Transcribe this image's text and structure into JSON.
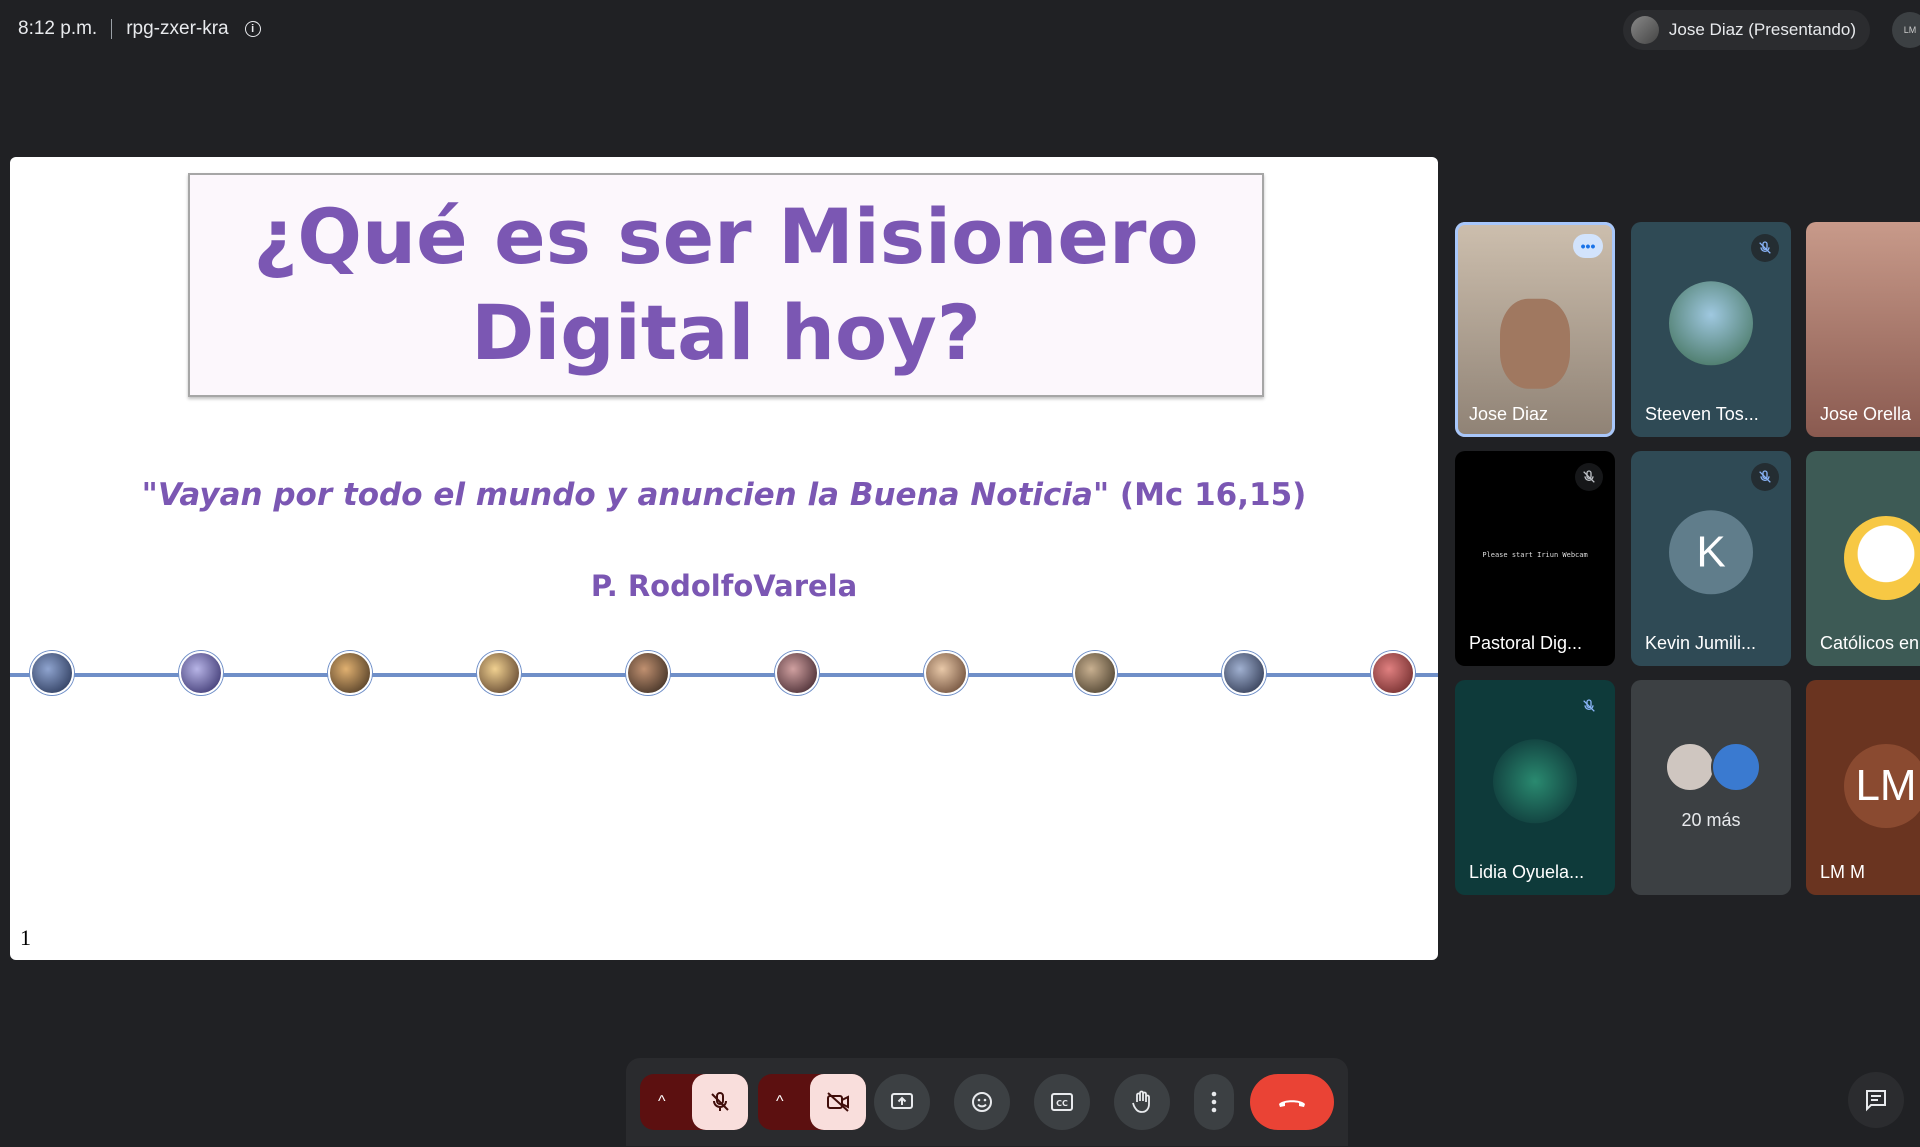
{
  "topbar": {
    "time": "8:12 p.m.",
    "meeting_code": "rpg-zxer-kra",
    "presenter_label": "Jose Diaz (Presentando)",
    "corner_initials": "LM"
  },
  "slide": {
    "title_line1": "¿Qué es ser Misionero",
    "title_line2": "Digital hoy?",
    "quote_text": "\"Vayan por todo el mundo y anuncien la Buena Noticia\"",
    "quote_ref": " (Mc 16,15)",
    "author": "P. RodolfoVarela",
    "page_number": "1"
  },
  "participants": [
    {
      "name": "Jose Diaz",
      "state": "speaking"
    },
    {
      "name": "Steeven Tos...",
      "state": "muted"
    },
    {
      "name": "Jose Orella",
      "state": "unknown"
    },
    {
      "name": "Pastoral Dig...",
      "state": "muted",
      "video_text": "Please start Iriun Webcam"
    },
    {
      "name": "Kevin Jumili...",
      "state": "muted",
      "initial": "K"
    },
    {
      "name": "Católicos en",
      "state": "unknown"
    },
    {
      "name": "Lidia Oyuela...",
      "state": "muted"
    },
    {
      "name": "20 más",
      "state": "overflow"
    },
    {
      "name": "LM M",
      "state": "unknown",
      "initial": "LM"
    }
  ],
  "colors": {
    "accent_purple": "#7b57b3",
    "end_call": "#ea4335",
    "background": "#202124"
  },
  "controls": {
    "mic": "mic-off-icon",
    "camera": "camera-off-icon",
    "present": "present-icon",
    "emoji": "emoji-icon",
    "captions": "captions-icon",
    "raise_hand": "hand-icon",
    "more": "more-vertical-icon",
    "end_call": "end-call-icon",
    "chat": "chat-icon"
  }
}
